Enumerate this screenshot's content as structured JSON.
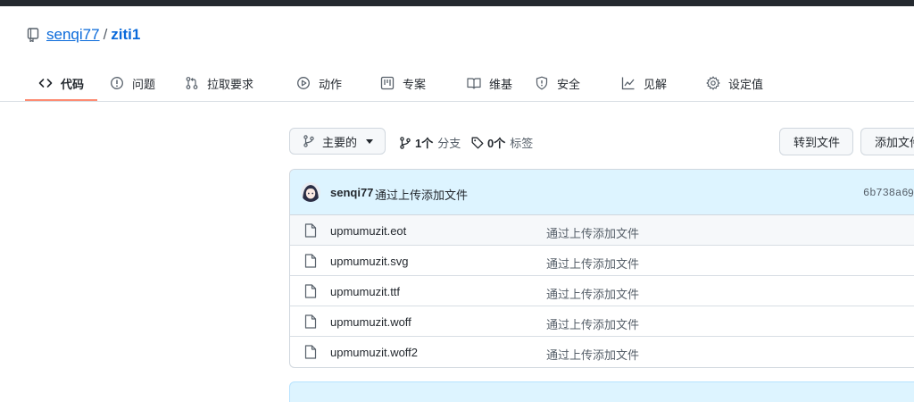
{
  "repo": {
    "owner": "senqi77",
    "separator": "/",
    "name": "ziti1"
  },
  "tabs": [
    {
      "label": "代码",
      "icon": "code-icon",
      "active": true
    },
    {
      "label": "问题",
      "icon": "issue-icon"
    },
    {
      "label": "拉取要求",
      "icon": "pull-request-icon"
    },
    {
      "label": "动作",
      "icon": "play-icon"
    },
    {
      "label": "专案",
      "icon": "project-icon"
    },
    {
      "label": "维基",
      "icon": "book-icon"
    },
    {
      "label": "安全",
      "icon": "shield-icon"
    },
    {
      "label": "见解",
      "icon": "graph-icon"
    },
    {
      "label": "设定值",
      "icon": "gear-icon"
    }
  ],
  "toolbar": {
    "branch_label": "主要的",
    "branches": {
      "count": "1个",
      "label": "分支"
    },
    "tags": {
      "count": "0个",
      "label": "标签"
    },
    "goto_file": "转到文件",
    "add_file": "添加文件"
  },
  "commit": {
    "author": "senqi77",
    "message": "通过上传添加文件",
    "sha": "6b738a6",
    "extra": "9"
  },
  "files": [
    {
      "name": "upmumuzit.eot",
      "message": "通过上传添加文件"
    },
    {
      "name": "upmumuzit.svg",
      "message": "通过上传添加文件"
    },
    {
      "name": "upmumuzit.ttf",
      "message": "通过上传添加文件"
    },
    {
      "name": "upmumuzit.woff",
      "message": "通过上传添加文件"
    },
    {
      "name": "upmumuzit.woff2",
      "message": "通过上传添加文件"
    }
  ],
  "colors": {
    "link": "#0969da",
    "accent_underline": "#fd8c73",
    "commit_bg": "#ddf4ff",
    "text": "#24292f",
    "muted": "#57606a"
  }
}
